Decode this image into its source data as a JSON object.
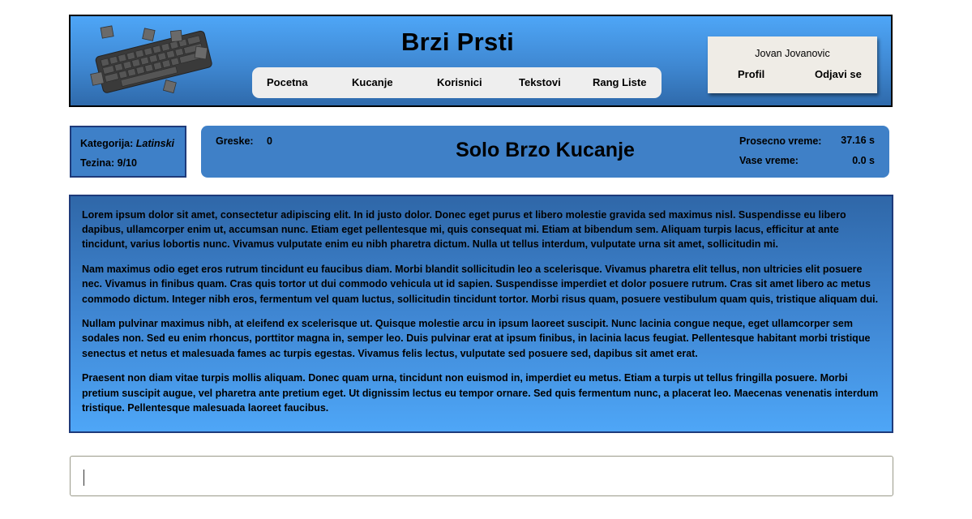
{
  "header": {
    "title": "Brzi Prsti",
    "nav": [
      "Pocetna",
      "Kucanje",
      "Korisnici",
      "Tekstovi",
      "Rang Liste"
    ],
    "user": {
      "name": "Jovan Jovanovic",
      "profile_label": "Profil",
      "logout_label": "Odjavi se"
    }
  },
  "category": {
    "category_label": "Kategorija:",
    "category_value": "Latinski",
    "difficulty_label": "Tezina:",
    "difficulty_value": "9/10"
  },
  "stats": {
    "errors_label": "Greske:",
    "errors_value": "0",
    "mode_title": "Solo Brzo Kucanje",
    "avg_time_label": "Prosecno vreme:",
    "avg_time_value": "37.16 s",
    "your_time_label": "Vase vreme:",
    "your_time_value": "0.0 s"
  },
  "text_panel": {
    "paragraphs": [
      "Lorem ipsum dolor sit amet, consectetur adipiscing elit. In id justo dolor. Donec eget purus et libero molestie gravida sed maximus nisl. Suspendisse eu libero dapibus, ullamcorper enim ut, accumsan nunc. Etiam eget pellentesque mi, quis consequat mi. Etiam at bibendum sem. Aliquam turpis lacus, efficitur at ante tincidunt, varius lobortis nunc. Vivamus vulputate enim eu nibh pharetra dictum. Nulla ut tellus interdum, vulputate urna sit amet, sollicitudin mi.",
      "Nam maximus odio eget eros rutrum tincidunt eu faucibus diam. Morbi blandit sollicitudin leo a scelerisque. Vivamus pharetra elit tellus, non ultricies elit posuere nec. Vivamus in finibus quam. Cras quis tortor ut dui commodo vehicula ut id sapien. Suspendisse imperdiet et dolor posuere rutrum. Cras sit amet libero ac metus commodo dictum. Integer nibh eros, fermentum vel quam luctus, sollicitudin tincidunt tortor. Morbi risus quam, posuere vestibulum quam quis, tristique aliquam dui.",
      "Nullam pulvinar maximus nibh, at eleifend ex scelerisque ut. Quisque molestie arcu in ipsum laoreet suscipit. Nunc lacinia congue neque, eget ullamcorper sem sodales non. Sed eu enim rhoncus, porttitor magna in, semper leo. Duis pulvinar erat at ipsum finibus, in lacinia lacus feugiat. Pellentesque habitant morbi tristique senectus et netus et malesuada fames ac turpis egestas. Vivamus felis lectus, vulputate sed posuere sed, dapibus sit amet erat.",
      "Praesent non diam vitae turpis mollis aliquam. Donec quam urna, tincidunt non euismod in, imperdiet eu metus. Etiam a turpis ut tellus fringilla posuere. Morbi pretium suscipit augue, vel pharetra ante pretium eget. Ut dignissim lectus eu tempor ornare. Sed quis fermentum nunc, a placerat leo. Maecenas venenatis interdum tristique. Pellentesque malesuada laoreet faucibus."
    ]
  },
  "input": {
    "value": "",
    "placeholder": ""
  },
  "icons": {
    "logo": "keyboard-logo-icon"
  },
  "colors": {
    "header_blue": "#4ea6f7",
    "panel_blue": "#3f80c7",
    "border_navy": "#1e3a7a",
    "nav_bg": "#eeeeee",
    "user_box_bg": "#efece6"
  }
}
